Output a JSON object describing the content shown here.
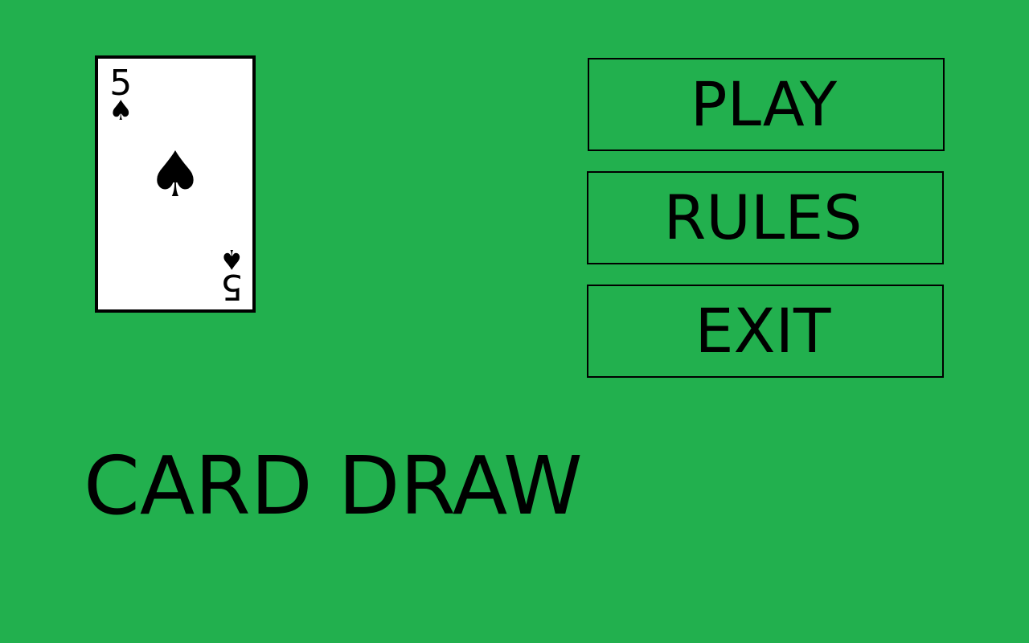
{
  "card": {
    "rank": "5",
    "suit_symbol": "♠",
    "suit_name": "spades"
  },
  "menu": {
    "play_label": "PLAY",
    "rules_label": "RULES",
    "exit_label": "EXIT"
  },
  "title": "CARD DRAW",
  "colors": {
    "background": "#22b04e",
    "card_face": "#ffffff",
    "ink": "#000000"
  }
}
